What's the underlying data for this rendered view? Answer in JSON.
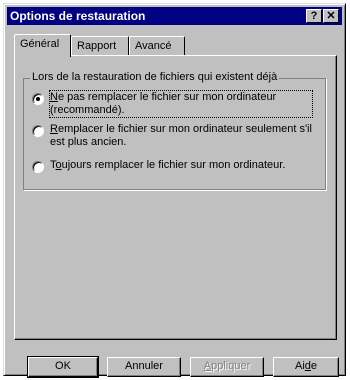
{
  "window": {
    "title": "Options de restauration",
    "help_glyph": "?",
    "close_glyph": "✕"
  },
  "tabs": [
    {
      "label": "Général",
      "active": true
    },
    {
      "label": "Rapport",
      "active": false
    },
    {
      "label": "Avancé",
      "active": false
    }
  ],
  "group": {
    "label": "Lors de la restauration de fichiers qui existent déjà",
    "options": [
      {
        "mnemonic": "N",
        "rest": "e pas remplacer le fichier sur mon ordinateur (recommandé).",
        "selected": true
      },
      {
        "mnemonic": "R",
        "rest": "emplacer le fichier sur mon ordinateur seulement s'il est plus ancien.",
        "selected": false
      },
      {
        "pre": "T",
        "mnemonic": "o",
        "rest": "ujours remplacer le fichier sur mon ordinateur.",
        "selected": false
      }
    ]
  },
  "buttons": {
    "ok": "OK",
    "cancel": "Annuler",
    "apply_mn": "A",
    "apply_rest": "ppliquer",
    "help_pre": "Ai",
    "help_mn": "d",
    "help_rest": "e"
  }
}
